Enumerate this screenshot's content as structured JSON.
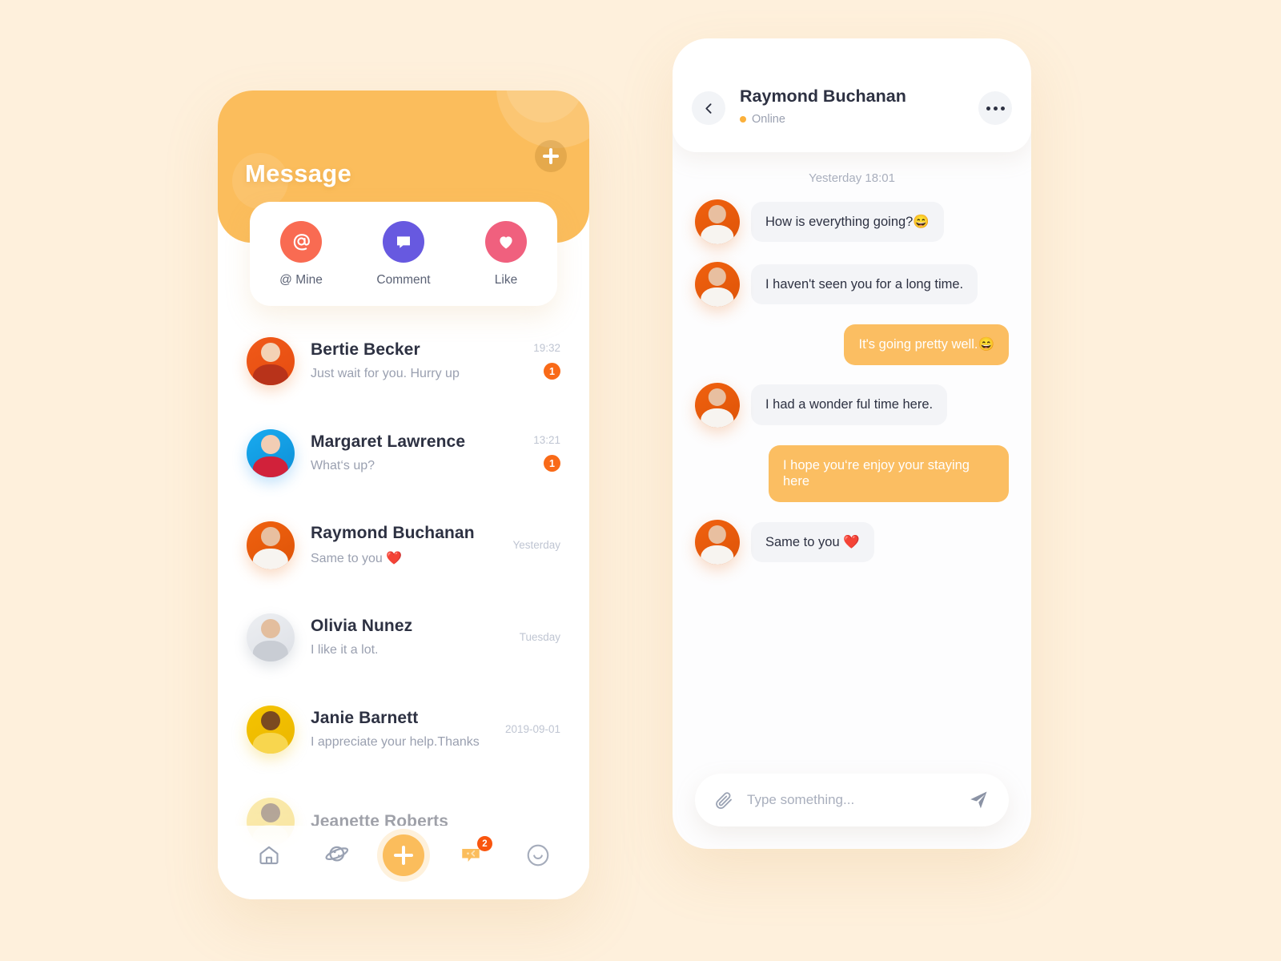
{
  "theme": {
    "page_bg": "#FEF0DC",
    "header_orange": "#FBBD5C",
    "accent_amber": "#FBBE62",
    "badge_orange": "#F96A18",
    "mine_coral": "#F96B52",
    "comment_purple": "#6759E0",
    "like_pink": "#F0607E",
    "text_dark": "#2D3142",
    "text_muted": "#9AA0B0"
  },
  "message_screen": {
    "title": "Message",
    "add_icon": "plus-icon",
    "categories": [
      {
        "label": "@ Mine",
        "icon": "at-icon",
        "color": "#F96B52"
      },
      {
        "label": "Comment",
        "icon": "comment-icon",
        "color": "#6759E0"
      },
      {
        "label": "Like",
        "icon": "heart-icon",
        "color": "#F0607E"
      }
    ],
    "conversations": [
      {
        "name": "Bertie Becker",
        "preview": "Just wait for you. Hurry up",
        "time": "19:32",
        "unread": "1",
        "avatar_bg": "#F05A19",
        "avatar_bg2": "#E64C10"
      },
      {
        "name": "Margaret Lawrence",
        "preview": "What‘s up?",
        "time": "13:21",
        "unread": "1",
        "avatar_bg": "#14A3E8",
        "avatar_bg2": "#0E8FD6"
      },
      {
        "name": "Raymond Buchanan",
        "preview": "Same to you ❤️",
        "time": "Yesterday",
        "unread": "",
        "avatar_bg": "#F0610F",
        "avatar_bg2": "#DE5408"
      },
      {
        "name": "Olivia Nunez",
        "preview": "I like it a lot.",
        "time": "Tuesday",
        "unread": "",
        "avatar_bg": "#EDEFF2",
        "avatar_bg2": "#DDE0E6"
      },
      {
        "name": "Janie Barnett",
        "preview": "I appreciate your help.Thanks",
        "time": "2019-09-01",
        "unread": "",
        "avatar_bg": "#F5C400",
        "avatar_bg2": "#EBB600"
      },
      {
        "name": "Jeanette Roberts",
        "preview": "",
        "time": "",
        "unread": "",
        "avatar_bg": "#F5D24A",
        "avatar_bg2": "#EFC62E"
      }
    ],
    "tabbar": [
      {
        "name": "home",
        "icon": "home-icon",
        "active": false,
        "badge": ""
      },
      {
        "name": "explore",
        "icon": "planet-icon",
        "active": false,
        "badge": ""
      },
      {
        "name": "create",
        "icon": "plus-icon",
        "active": false,
        "badge": ""
      },
      {
        "name": "messages",
        "icon": "chat-icon",
        "active": true,
        "badge": "2"
      },
      {
        "name": "profile",
        "icon": "smiley-icon",
        "active": false,
        "badge": ""
      }
    ]
  },
  "chat_screen": {
    "back_icon": "chevron-left-icon",
    "contact_name": "Raymond Buchanan",
    "status": "Online",
    "more_icon": "more-horizontal-icon",
    "date_divider": "Yesterday 18:01",
    "messages": [
      {
        "from": "them",
        "text": "How is everything going?😄"
      },
      {
        "from": "them",
        "text": "I haven't seen you for a long time."
      },
      {
        "from": "me",
        "text": "It's going pretty well.😄"
      },
      {
        "from": "them",
        "text": "I had a wonder ful time here."
      },
      {
        "from": "me",
        "text": "I hope you‘re enjoy your staying here"
      },
      {
        "from": "them",
        "text": "Same to you ❤️"
      }
    ],
    "input": {
      "placeholder": "Type something...",
      "value": "",
      "attach_icon": "paperclip-icon",
      "send_icon": "send-icon"
    }
  }
}
